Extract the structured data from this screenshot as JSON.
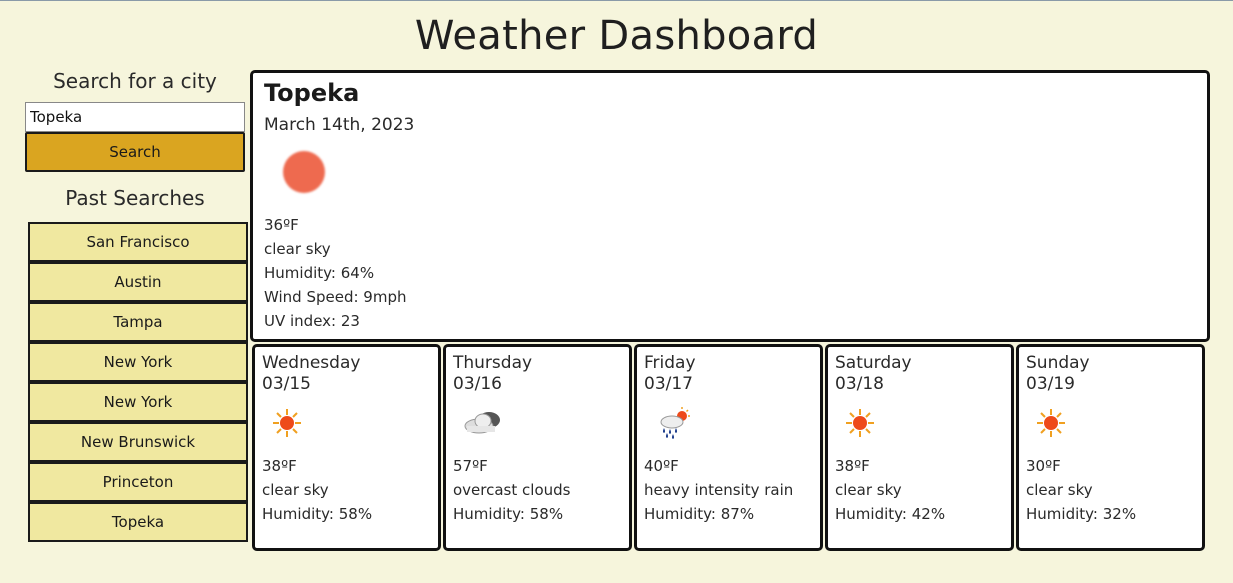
{
  "header": {
    "title": "Weather Dashboard"
  },
  "sidebar": {
    "search_label": "Search for a city",
    "search_value": "Topeka",
    "search_button": "Search",
    "past_label": "Past Searches",
    "past_searches": [
      "San Francisco",
      "Austin",
      "Tampa",
      "New York",
      "New York",
      "New Brunswick",
      "Princeton",
      "Topeka"
    ]
  },
  "current": {
    "city": "Topeka",
    "date": "March 14th, 2023",
    "icon": "sun-icon",
    "temp": "36ºF",
    "description": "clear sky",
    "humidity": "Humidity: 64%",
    "wind": "Wind Speed: 9mph",
    "uv": "UV index: 23"
  },
  "forecast": [
    {
      "day": "Wednesday",
      "date": "03/15",
      "icon": "sun-icon",
      "temp": "38ºF",
      "description": "clear sky",
      "humidity": "Humidity: 58%"
    },
    {
      "day": "Thursday",
      "date": "03/16",
      "icon": "cloud-icon",
      "temp": "57ºF",
      "description": "overcast clouds",
      "humidity": "Humidity: 58%"
    },
    {
      "day": "Friday",
      "date": "03/17",
      "icon": "rain-icon",
      "temp": "40ºF",
      "description": "heavy intensity rain",
      "humidity": "Humidity: 87%"
    },
    {
      "day": "Saturday",
      "date": "03/18",
      "icon": "sun-icon",
      "temp": "38ºF",
      "description": "clear sky",
      "humidity": "Humidity: 42%"
    },
    {
      "day": "Sunday",
      "date": "03/19",
      "icon": "sun-icon",
      "temp": "30ºF",
      "description": "clear sky",
      "humidity": "Humidity: 32%"
    }
  ],
  "colors": {
    "background": "#f6f5dc",
    "search_button": "#daa520",
    "past_item": "#f0e8a0",
    "sun_big": "#ee6a4f"
  }
}
